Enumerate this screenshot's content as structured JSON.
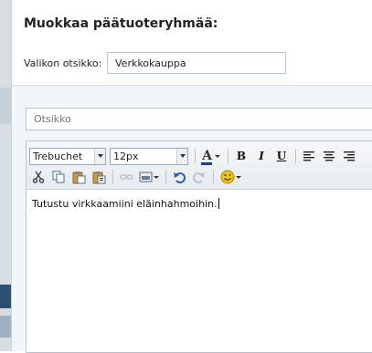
{
  "dialog": {
    "title": "Muokkaa päätuoteryhmää:",
    "menu_title_label": "Valikon otsikko:",
    "menu_title_value": "Verkkokauppa",
    "title_placeholder": "Otsikko"
  },
  "editor": {
    "toolbar": {
      "font_family": "Trebuchet",
      "font_size": "12px",
      "font_color_label": "A",
      "bold_label": "B",
      "italic_label": "I",
      "underline_label": "U"
    },
    "content": "Tutustu virkkaamiini eläinhahmoihin."
  },
  "colors": {
    "accent": "#3b5f86",
    "font_color_bar": "#1f3f8a",
    "undo": "#2f5fae",
    "smiley": "#f1c40f"
  },
  "icons": [
    "cut-icon",
    "copy-icon",
    "paste-icon",
    "paste-text-icon",
    "link-icon",
    "insert-image-icon",
    "undo-icon",
    "redo-icon",
    "smiley-icon",
    "align-left-icon",
    "align-center-icon",
    "align-right-icon"
  ]
}
